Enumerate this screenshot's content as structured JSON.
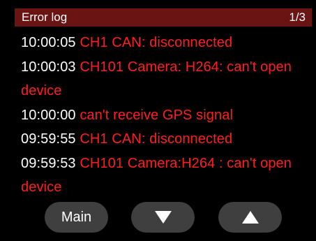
{
  "header": {
    "title": "Error log",
    "page_indicator": "1/3"
  },
  "log": {
    "entries": [
      {
        "time": "10:00:05",
        "message": "CH1 CAN: disconnected"
      },
      {
        "time": "10:00:03",
        "message": "CH101 Camera: H264: can't open device"
      },
      {
        "time": "10:00:00",
        "message": "can't receive GPS signal"
      },
      {
        "time": "09:59:55",
        "message": "CH1 CAN: disconnected"
      },
      {
        "time": "09:59:53",
        "message": "CH101 Camera:H264 : can't open device"
      }
    ]
  },
  "buttons": {
    "main_label": "Main",
    "down_icon": "triangle-down-icon",
    "up_icon": "triangle-up-icon"
  },
  "colors": {
    "header_bg": "#6b1414",
    "error_text": "#ff1e1e",
    "time_text": "#ffffff",
    "button_bg": "#3f3f3f",
    "background": "#000000"
  }
}
